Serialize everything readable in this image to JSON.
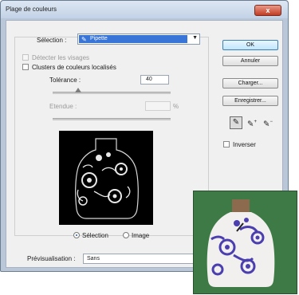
{
  "window": {
    "title": "Plage de couleurs",
    "close_label": "x"
  },
  "selection": {
    "label": "Sélection :",
    "value": "Pipette"
  },
  "detect_faces": {
    "label": "Détecter les visages"
  },
  "localized": {
    "label": "Clusters de couleurs localisés"
  },
  "tolerance": {
    "label": "Tolérance :",
    "value": "40"
  },
  "range": {
    "label": "Etendue :",
    "unit": "%"
  },
  "radios": {
    "selection_label": "Sélection",
    "image_label": "Image",
    "selected": "Sélection"
  },
  "preview_select": {
    "label": "Prévisualisation :",
    "value": "Sans"
  },
  "buttons": {
    "ok": "OK",
    "cancel": "Annuler",
    "load": "Charger...",
    "save": "Enregistrer..."
  },
  "invert": {
    "label": "Inverser"
  },
  "tools": [
    "eyedropper-icon",
    "eyedropper-plus-icon",
    "eyedropper-minus-icon"
  ],
  "colors": {
    "accent": "#3875d7",
    "window_frame": "#b9c7d8",
    "photo_bg": "#3e7a45",
    "flower": "#4b3fb0"
  }
}
